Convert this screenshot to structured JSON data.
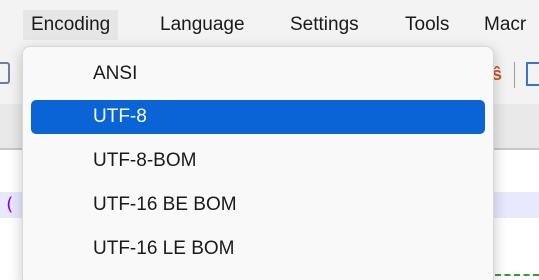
{
  "menubar": {
    "items": [
      {
        "label": "Encoding"
      },
      {
        "label": "Language"
      },
      {
        "label": "Settings"
      },
      {
        "label": "Tools"
      },
      {
        "label": "Macr"
      }
    ]
  },
  "toolbar": {
    "right_icon_glyph": "ŝ"
  },
  "editor": {
    "visible_char": "("
  },
  "encoding_menu": {
    "selected": "UTF-8",
    "accent_color": "#0a64d6",
    "items": [
      {
        "label": "ANSI"
      },
      {
        "label": "UTF-8"
      },
      {
        "label": "UTF-8-BOM"
      },
      {
        "label": "UTF-16 BE BOM"
      },
      {
        "label": "UTF-16 LE BOM"
      }
    ]
  }
}
